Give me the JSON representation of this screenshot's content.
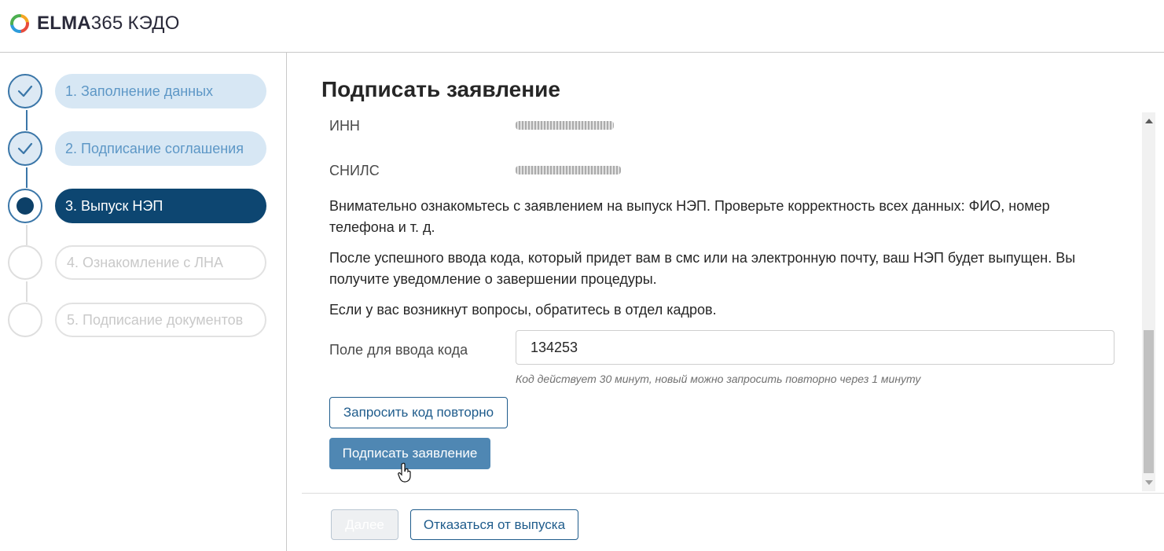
{
  "header": {
    "brand": "ELMA",
    "brand_number": "365",
    "product": "КЭДО",
    "logo_icon": "elma-logo-icon"
  },
  "steps": [
    {
      "label": "1. Заполнение данных",
      "state": "done"
    },
    {
      "label": "2. Подписание соглашения",
      "state": "done"
    },
    {
      "label": "3. Выпуск НЭП",
      "state": "active"
    },
    {
      "label": "4. Ознакомление с ЛНА",
      "state": "todo"
    },
    {
      "label": "5. Подписание документов",
      "state": "todo"
    }
  ],
  "main": {
    "title": "Подписать заявление",
    "inn_label": "ИНН",
    "snils_label": "СНИЛС",
    "paragraph_1": "Внимательно ознакомьтесь с заявлением на выпуск НЭП. Проверьте корректность всех данных: ФИО, номер телефона и т. д.",
    "paragraph_2": "После успешного ввода кода, который придет вам в смс или на электронную почту, ваш НЭП будет выпущен. Вы получите уведомление о завершении процедуры.",
    "paragraph_3": "Если у вас возникнут вопросы, обратитесь в отдел кадров.",
    "code_label": "Поле для ввода кода",
    "code_value": "134253",
    "code_hint": "Код действует 30 минут, новый можно запросить повторно через 1 минуту",
    "resend_button": "Запросить код повторно",
    "sign_button": "Подписать заявление"
  },
  "footer": {
    "next_button": "Далее",
    "decline_button": "Отказаться от выпуска"
  },
  "colors": {
    "accent": "#0d4671",
    "done_pill": "#d7e7f4",
    "primary_button": "#4f87b3"
  }
}
